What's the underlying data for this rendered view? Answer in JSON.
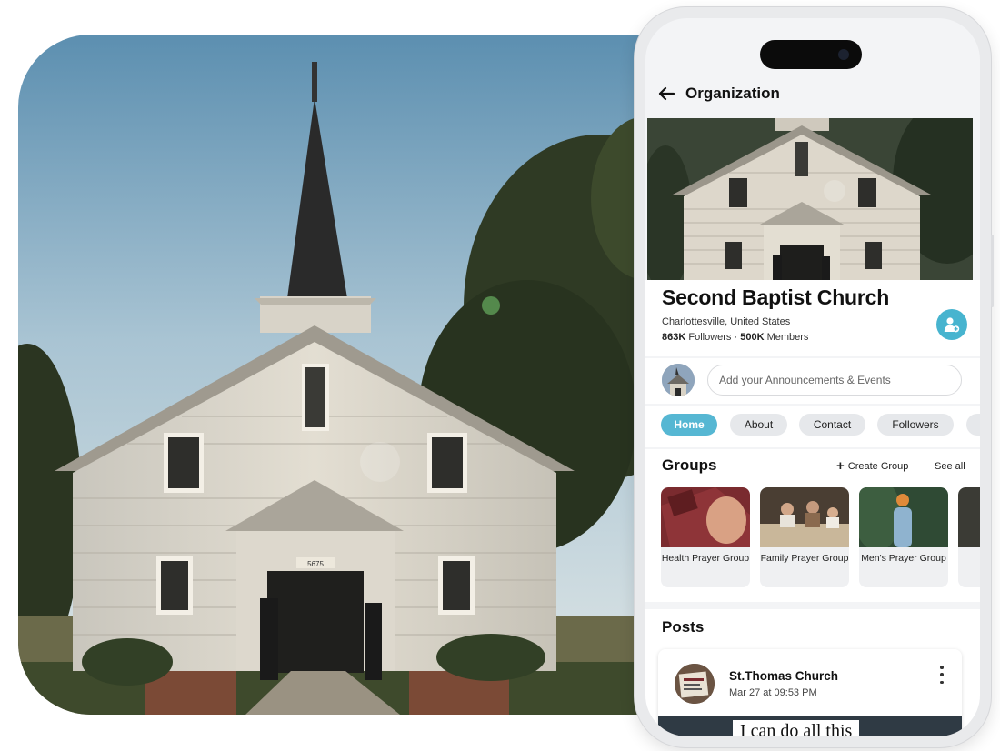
{
  "header": {
    "title": "Organization"
  },
  "organization": {
    "name": "Second Baptist Church",
    "location": "Charlottesville, United States",
    "followers": "863K",
    "followers_label": "Followers",
    "separator": "·",
    "members": "500K",
    "members_label": "Members"
  },
  "composer": {
    "placeholder": "Add your Announcements & Events"
  },
  "tabs": [
    {
      "label": "Home",
      "active": true
    },
    {
      "label": "About"
    },
    {
      "label": "Contact"
    },
    {
      "label": "Followers"
    }
  ],
  "groups": {
    "title": "Groups",
    "create_label": "Create Group",
    "see_all_label": "See all",
    "items": [
      {
        "name": "Health Prayer Group"
      },
      {
        "name": "Family Prayer Group"
      },
      {
        "name": "Men's Prayer Group"
      }
    ]
  },
  "posts": {
    "title": "Posts",
    "items": [
      {
        "author": "St.Thomas Church",
        "time": "Mar 27 at 09:53 PM",
        "media_text": "I can do all this"
      }
    ]
  },
  "church_sign": "5675",
  "colors": {
    "accent": "#56b7d3",
    "join_button": "#47b4cf"
  },
  "icons": {
    "back": "arrow-left-icon",
    "join": "add-member-icon",
    "create": "plus-icon",
    "more": "kebab-icon"
  }
}
